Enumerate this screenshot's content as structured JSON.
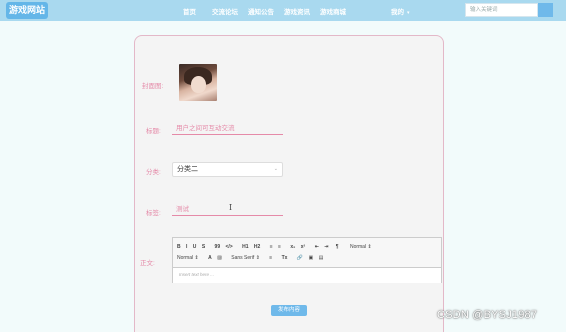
{
  "header": {
    "logo": "游戏网站",
    "nav": [
      "首页",
      "交流论坛",
      "通知公告",
      "游戏资讯",
      "游戏商城"
    ],
    "user_menu": "我的",
    "search_placeholder": "输入关键词"
  },
  "form": {
    "cover_label": "封面图:",
    "title_label": "标题:",
    "title_value": "用户之间可互动交流",
    "category_label": "分类:",
    "category_value": "分类二",
    "tags_label": "标签:",
    "tags_value": "测试",
    "body_label": "正文:",
    "editor": {
      "toolbar_row1": [
        "B",
        "I",
        "U",
        "S",
        "99",
        "</>",
        "H1",
        "H2",
        "≡",
        "≡",
        "x₂",
        "x²",
        "⇤",
        "⇥",
        "¶",
        "Normal ⇕"
      ],
      "toolbar_row2": [
        "Normal ⇕",
        "A",
        "▨",
        "Sans Serif ⇕",
        "≡",
        "Tx",
        "🔗",
        "▣",
        "▤"
      ],
      "placeholder": "Insert text here ..."
    },
    "submit_label": "发布内容"
  },
  "watermark": "CSDN @BYSJ1987"
}
